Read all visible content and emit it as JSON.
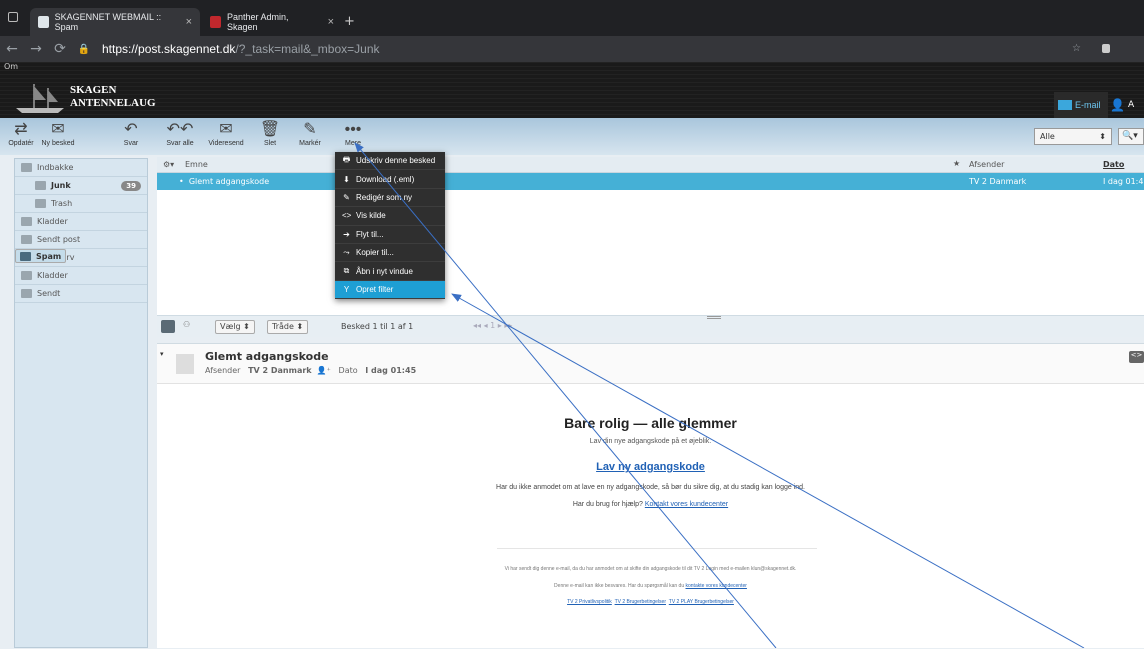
{
  "browser": {
    "tabs": [
      {
        "title": "SKAGENNET WEBMAIL :: Spam",
        "close": "×"
      },
      {
        "title": "Panther Admin, Skagen",
        "close": "×"
      }
    ],
    "new_tab": "+",
    "url_host": "https://post.skagennet.dk",
    "url_rest": "/?_task=mail&_mbox=Junk"
  },
  "header": {
    "top_link": "Om",
    "logo_line1": "SKAGEN",
    "logo_line2": "ANTENNELAUG",
    "email_tab": "E-mail",
    "account": "A"
  },
  "toolbar": {
    "refresh": "Opdatér",
    "compose": "Ny besked",
    "reply": "Svar",
    "reply_all": "Svar alle",
    "forward": "Videresend",
    "delete": "Slet",
    "mark": "Markér",
    "more": "Mere",
    "filter": "Alle"
  },
  "sidebar": [
    {
      "label": "Indbakke"
    },
    {
      "label": "Junk",
      "count": "39"
    },
    {
      "label": "Trash"
    },
    {
      "label": "Kladder"
    },
    {
      "label": "Sendt post"
    },
    {
      "label": "Spam"
    },
    {
      "label": "Papirkurv"
    },
    {
      "label": "Kladder"
    },
    {
      "label": "Sendt"
    }
  ],
  "list": {
    "col_subject": "Emne",
    "col_sender": "Afsender",
    "col_date": "Dato",
    "row_subject": "Glemt adgangskode",
    "row_sender": "TV 2 Danmark",
    "row_date": "I dag 01:4",
    "footer_select": "Vælg",
    "footer_thread": "Tråde",
    "footer_count": "Besked 1 til 1 af 1",
    "page": "1"
  },
  "menu": [
    {
      "label": "Udskriv denne besked",
      "icon": "🖶"
    },
    {
      "label": "Download (.eml)",
      "icon": "⬇"
    },
    {
      "label": "Redigér som ny",
      "icon": "✎"
    },
    {
      "label": "Vis kilde",
      "icon": "<>"
    },
    {
      "label": "Flyt til...",
      "icon": "➔"
    },
    {
      "label": "Kopier til...",
      "icon": "⤳"
    },
    {
      "label": "Åbn i nyt vindue",
      "icon": "⧉"
    },
    {
      "label": "Opret filter",
      "icon": "Y"
    }
  ],
  "preview": {
    "subject": "Glemt adgangskode",
    "sender_label": "Afsender",
    "sender": "TV 2 Danmark",
    "date_label": "Dato",
    "date": "I dag 01:45",
    "heading": "Bare rolig — alle glemmer",
    "sub": "Lav din nye adgangskode på et øjeblik.",
    "cta": "Lav ny adgangskode",
    "p1": "Har du ikke anmodet om at lave en ny adgangskode, så bør du sikre dig, at du stadig kan logge ind.",
    "p2_text": "Har du brug for hjælp? ",
    "p2_link": "Kontakt vores kundecenter",
    "foot1": "Vi har sendt dig denne e-mail, da du har anmodet om at skifte din adgangskode til dit TV 2 Login med e-mailen klun@skagennet.dk.",
    "foot2_text": "Denne e-mail kan ikke besvares. Har du spørgsmål kan du ",
    "foot2_link": "kontakte vores kundecenter",
    "foot3_a": "TV 2 Privatlivspolitik",
    "foot3_b": "TV 2 Brugerbetingelser",
    "foot3_c": "TV 2 PLAY Brugerbetingelser"
  }
}
